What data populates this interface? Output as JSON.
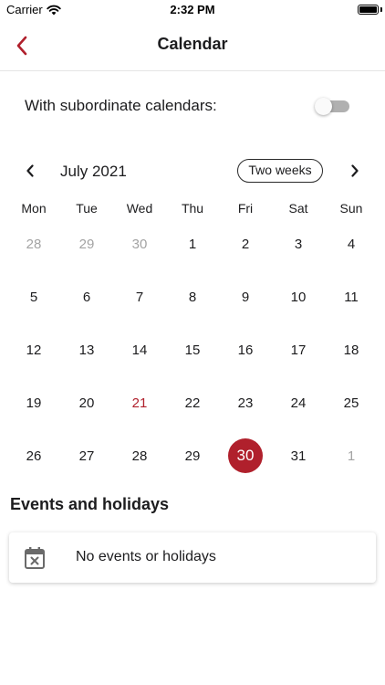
{
  "status_bar": {
    "carrier": "Carrier",
    "time": "2:32 PM",
    "wifi_icon": "wifi-icon",
    "battery_icon": "battery-full-icon"
  },
  "header": {
    "title": "Calendar",
    "back_icon": "chevron-left-icon",
    "accent_color": "#b0202c"
  },
  "settings": {
    "subordinate_label": "With subordinate calendars:",
    "subordinate_enabled": false
  },
  "calendar": {
    "month_label": "July 2021",
    "period_button_label": "Two weeks",
    "prev_icon": "chevron-left-icon",
    "next_icon": "chevron-right-icon",
    "weekdays": [
      "Mon",
      "Tue",
      "Wed",
      "Thu",
      "Fri",
      "Sat",
      "Sun"
    ],
    "weeks": [
      [
        {
          "d": "28",
          "outside": true
        },
        {
          "d": "29",
          "outside": true
        },
        {
          "d": "30",
          "outside": true
        },
        {
          "d": "1"
        },
        {
          "d": "2"
        },
        {
          "d": "3"
        },
        {
          "d": "4"
        }
      ],
      [
        {
          "d": "5"
        },
        {
          "d": "6"
        },
        {
          "d": "7"
        },
        {
          "d": "8"
        },
        {
          "d": "9"
        },
        {
          "d": "10"
        },
        {
          "d": "11"
        }
      ],
      [
        {
          "d": "12"
        },
        {
          "d": "13"
        },
        {
          "d": "14"
        },
        {
          "d": "15"
        },
        {
          "d": "16"
        },
        {
          "d": "17"
        },
        {
          "d": "18"
        }
      ],
      [
        {
          "d": "19"
        },
        {
          "d": "20"
        },
        {
          "d": "21",
          "holiday": true
        },
        {
          "d": "22"
        },
        {
          "d": "23"
        },
        {
          "d": "24"
        },
        {
          "d": "25"
        }
      ],
      [
        {
          "d": "26"
        },
        {
          "d": "27"
        },
        {
          "d": "28"
        },
        {
          "d": "29"
        },
        {
          "d": "30",
          "selected": true
        },
        {
          "d": "31"
        },
        {
          "d": "1",
          "outside": true
        }
      ]
    ],
    "selected_color": "#b0202c",
    "holiday_color": "#b0202c",
    "outside_color": "#a3a3a3"
  },
  "events": {
    "title": "Events and holidays",
    "empty_icon": "calendar-remove-icon",
    "empty_text": "No events or holidays"
  }
}
